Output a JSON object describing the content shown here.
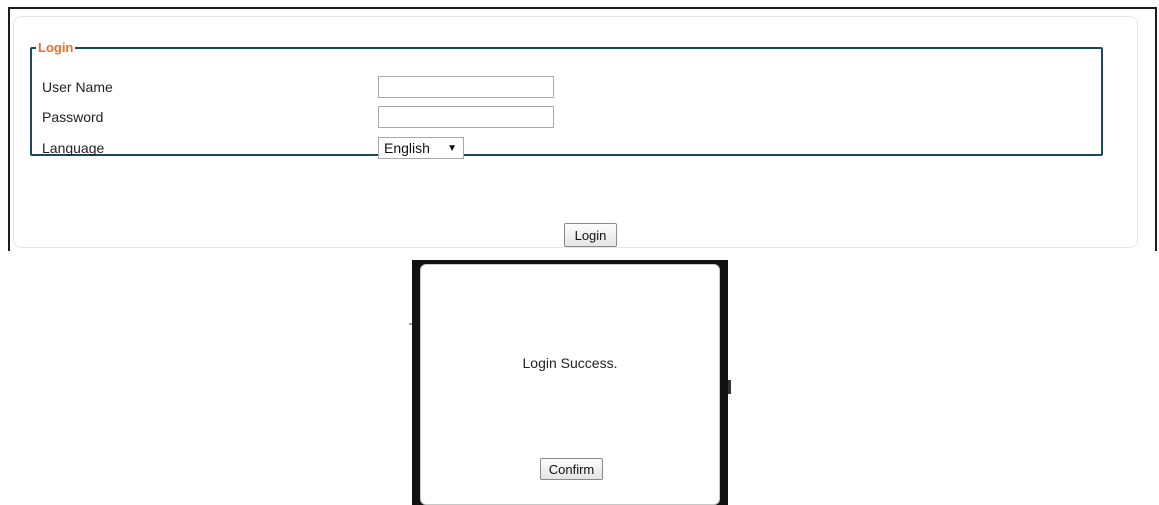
{
  "login_form": {
    "legend": "Login",
    "username_label": "User Name",
    "username_value": "",
    "password_label": "Password",
    "password_value": "",
    "language_label": "Language",
    "language_selected": "English",
    "language_caret": "▼",
    "login_button": "Login"
  },
  "dialog": {
    "message": "Login Success.",
    "confirm_button": "Confirm"
  },
  "colors": {
    "legend": "#e8702a",
    "fieldset_border": "#1a4a5a"
  }
}
